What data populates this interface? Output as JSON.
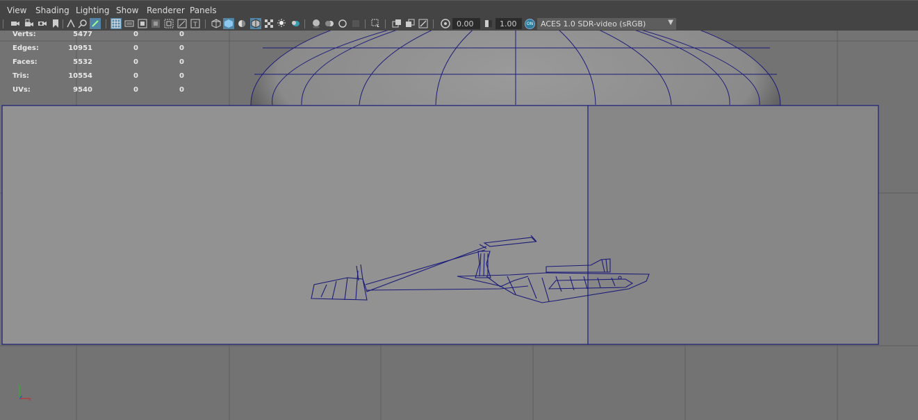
{
  "menu": [
    "View",
    "Shading",
    "Lighting",
    "Show",
    "Renderer",
    "Panels"
  ],
  "toolbar": {
    "exposure_value": "0.00",
    "gamma_value": "1.00",
    "color_management_toggle": "ON",
    "color_space": "ACES 1.0 SDR-video (sRGB)"
  },
  "hud": [
    {
      "label": "Verts:",
      "values": [
        "5477",
        "0",
        "0"
      ]
    },
    {
      "label": "Edges:",
      "values": [
        "10951",
        "0",
        "0"
      ]
    },
    {
      "label": "Faces:",
      "values": [
        "5532",
        "0",
        "0"
      ]
    },
    {
      "label": "Tris:",
      "values": [
        "10554",
        "0",
        "0"
      ]
    },
    {
      "label": "UVs:",
      "values": [
        "9540",
        "0",
        "0"
      ]
    }
  ],
  "axis": {
    "y": "y",
    "x": "x"
  },
  "colors": {
    "wireframe": "#1a1a7a",
    "viewport_bg": "#737373",
    "toolbar_active": "#5285a6",
    "axis_x": "#c03030",
    "axis_y": "#30b030"
  }
}
